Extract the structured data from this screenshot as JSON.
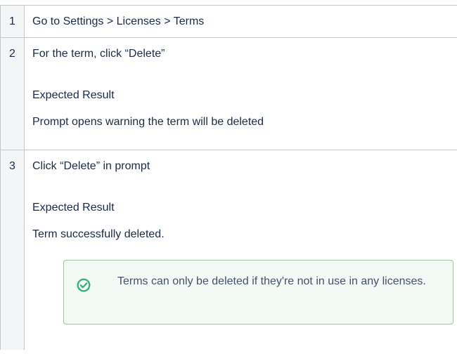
{
  "steps": [
    {
      "number": "1",
      "action": "Go to Settings > Licenses > Terms"
    },
    {
      "number": "2",
      "action": "For the term, click “Delete”",
      "expected_label": "Expected Result",
      "expected": "Prompt opens warning the term will be deleted"
    },
    {
      "number": "3",
      "action": "Click “Delete” in prompt",
      "expected_label": "Expected Result",
      "expected": "Term successfully deleted.",
      "note": {
        "icon": "check-circle-icon",
        "text": "Terms can only be deleted if they're not in use in any licenses.",
        "accent_color": "#36b37e",
        "background_color": "#f3f9f4"
      }
    }
  ]
}
